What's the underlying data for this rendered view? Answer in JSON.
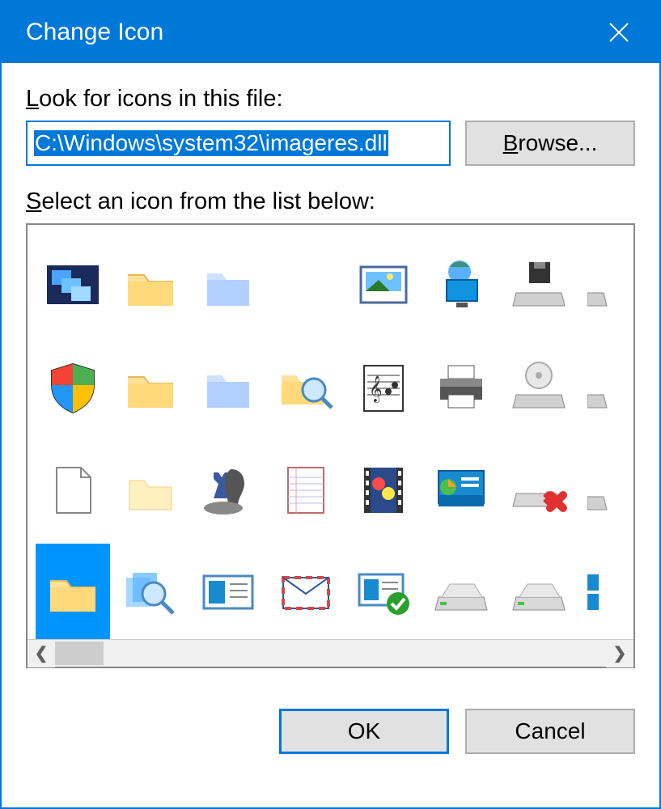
{
  "title": "Change Icon",
  "lookLabelPrefix": "L",
  "lookLabelRest": "ook for icons in this file:",
  "filePath": "C:\\Windows\\system32\\imageres.dll",
  "browseLabelPrefix": "B",
  "browseLabelRest": "rowse...",
  "selectLabelPrefix": "S",
  "selectLabelRest": "elect an icon from the list below:",
  "okLabel": "OK",
  "cancelLabel": "Cancel",
  "selectedIndex": 24,
  "icons": [
    "network-collection",
    "folder",
    "folder-glass",
    "blank",
    "picture",
    "network-monitor",
    "floppy-drive",
    "drive-partial",
    "shield-windows",
    "folder",
    "folder-glass",
    "folder-search",
    "music-sheet",
    "printer",
    "disc-drive",
    "drive-partial",
    "document-blank",
    "folder-light",
    "games-chess",
    "document-lined",
    "video-clip",
    "control-panel",
    "drive-disconnect",
    "drive-partial",
    "folder",
    "search",
    "contact-card",
    "email-envelope",
    "contact-ok",
    "drive",
    "drive",
    "windows-partial"
  ]
}
